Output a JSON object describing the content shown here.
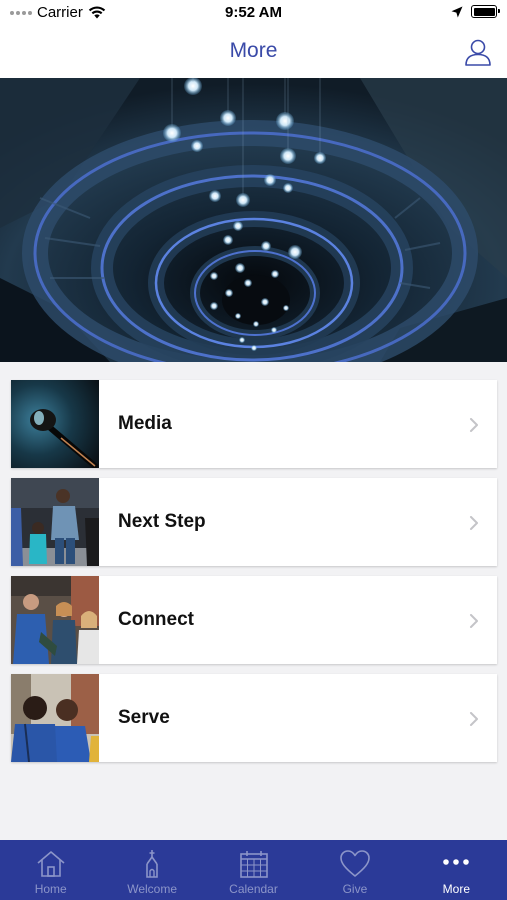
{
  "status_bar": {
    "carrier": "Carrier",
    "time": "9:52 AM"
  },
  "nav": {
    "title": "More",
    "title_color": "#3a4aa8"
  },
  "hero": {
    "image": "spiral-staircase-with-hanging-lights"
  },
  "menu": [
    {
      "label": "Media",
      "thumb": "microphone-photo"
    },
    {
      "label": "Next Step",
      "thumb": "people-walking-photo"
    },
    {
      "label": "Connect",
      "thumb": "people-talking-photo"
    },
    {
      "label": "Serve",
      "thumb": "volunteers-photo"
    }
  ],
  "tabs": [
    {
      "label": "Home",
      "icon": "home-icon",
      "active": false
    },
    {
      "label": "Welcome",
      "icon": "church-icon",
      "active": false
    },
    {
      "label": "Calendar",
      "icon": "calendar-icon",
      "active": false
    },
    {
      "label": "Give",
      "icon": "heart-icon",
      "active": false
    },
    {
      "label": "More",
      "icon": "more-icon",
      "active": true
    }
  ],
  "colors": {
    "tab_bar": "#2b3a98",
    "tab_inactive": "#8c95c9",
    "tab_active": "#ffffff",
    "background": "#f2f2f4"
  }
}
